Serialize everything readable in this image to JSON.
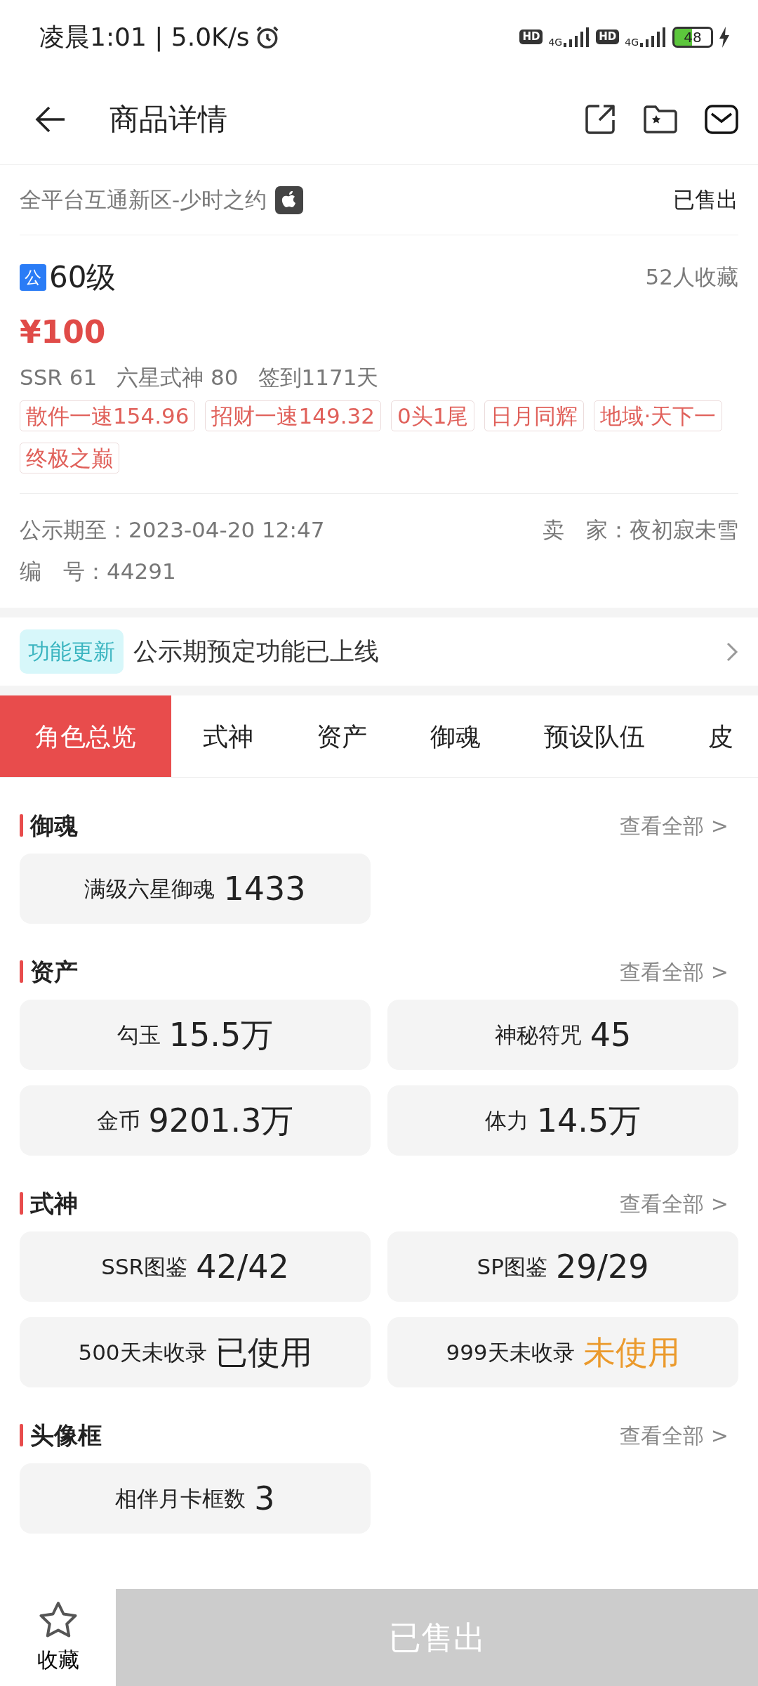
{
  "status_bar": {
    "left_text": "凌晨1:01 | 5.0K/s",
    "sims": [
      {
        "badge": "HD",
        "network": "4G"
      },
      {
        "badge": "HD",
        "network": "4G"
      }
    ],
    "battery": "48"
  },
  "header": {
    "title": "商品详情"
  },
  "server": {
    "name": "全平台互通新区-少时之约",
    "status": "已售出"
  },
  "listing": {
    "badge": "公",
    "level": "60级",
    "favorites": "52人收藏",
    "price": "¥100",
    "stats": [
      "SSR 61",
      "六星式神 80",
      "签到1171天"
    ],
    "tags": [
      "散件一速154.96",
      "招财一速149.32",
      "0头1尾",
      "日月同辉",
      "地域·天下一",
      "终极之巅"
    ]
  },
  "info": {
    "deadline": "公示期至：2023-04-20 12:47",
    "seller": "卖　家：夜初寂未雪",
    "number": "编　号：44291"
  },
  "notice": {
    "badge": "功能更新",
    "text": "公示期预定功能已上线"
  },
  "tabs": [
    {
      "label": "角色总览",
      "selected": true
    },
    {
      "label": "式神",
      "selected": false
    },
    {
      "label": "资产",
      "selected": false
    },
    {
      "label": "御魂",
      "selected": false
    },
    {
      "label": "预设队伍",
      "selected": false
    },
    {
      "label": "皮",
      "selected": false
    }
  ],
  "sections": [
    {
      "title": "御魂",
      "link": "查看全部 >",
      "cards": [
        {
          "label": "满级六星御魂",
          "value": "1433",
          "highlighted": false
        }
      ]
    },
    {
      "title": "资产",
      "link": "查看全部 >",
      "cards": [
        {
          "label": "勾玉",
          "value": "15.5万",
          "highlighted": false
        },
        {
          "label": "神秘符咒",
          "value": "45",
          "highlighted": false
        },
        {
          "label": "金币",
          "value": "9201.3万",
          "highlighted": false
        },
        {
          "label": "体力",
          "value": "14.5万",
          "highlighted": false
        }
      ]
    },
    {
      "title": "式神",
      "link": "查看全部 >",
      "cards": [
        {
          "label": "SSR图鉴",
          "value": "42/42",
          "highlighted": false
        },
        {
          "label": "SP图鉴",
          "value": "29/29",
          "highlighted": false
        },
        {
          "label": "500天未收录",
          "value": "已使用",
          "highlighted": false
        },
        {
          "label": "999天未收录",
          "value": "未使用",
          "highlighted": true
        }
      ]
    },
    {
      "title": "头像框",
      "link": "查看全部 >",
      "cards": [
        {
          "label": "相伴月卡框数",
          "value": "3",
          "highlighted": false
        }
      ]
    }
  ],
  "bottom": {
    "favorite_label": "收藏",
    "action": "已售出"
  }
}
